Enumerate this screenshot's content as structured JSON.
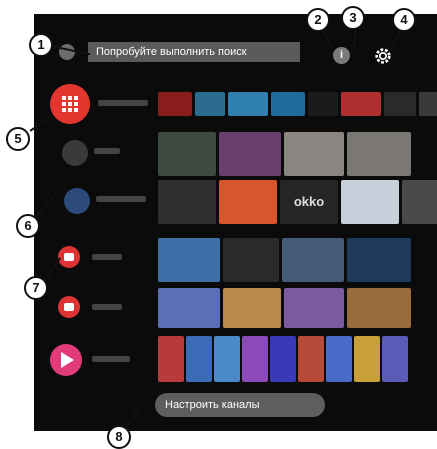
{
  "search": {
    "placeholder": "Попробуйте выполнить поиск"
  },
  "top": {
    "info_label": "i"
  },
  "callouts": [
    "1",
    "2",
    "3",
    "4",
    "5",
    "6",
    "7",
    "8"
  ],
  "channels_button": {
    "label": "Настроить каналы"
  },
  "okko_label": "okko",
  "colors": {
    "apps": "#e3362f",
    "youtube": "#d33333",
    "kinopoisk": "#e23b79"
  }
}
